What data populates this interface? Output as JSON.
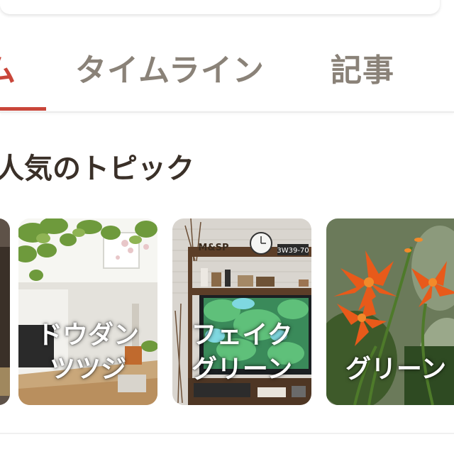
{
  "tabs": [
    {
      "label": "ム",
      "active": true
    },
    {
      "label": "タイムライン",
      "active": false
    },
    {
      "label": "記事",
      "active": false
    }
  ],
  "section": {
    "title": "人気のトピック"
  },
  "topics": [
    {
      "line1": "",
      "line2": ""
    },
    {
      "line1": "ドウダン",
      "line2": "ツツジ"
    },
    {
      "line1": "フェイク",
      "line2": "グリーン"
    },
    {
      "line1": "グリーン",
      "line2": ""
    }
  ],
  "photo_text": {
    "shelf_sign": "M&SP",
    "plate": "3W39-70"
  },
  "colors": {
    "accent": "#c9463a",
    "tab_inactive": "#8a8278",
    "title": "#3a3028"
  }
}
